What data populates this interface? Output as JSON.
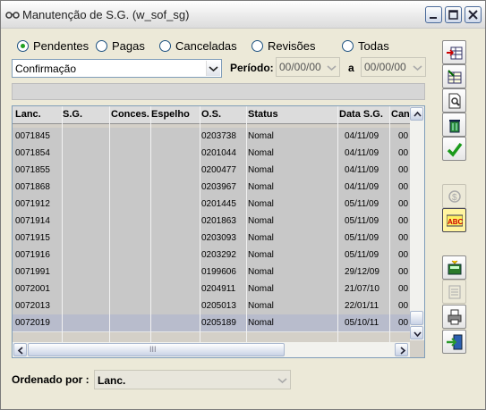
{
  "window": {
    "title": "Manutenção de S.G. (w_sof_sg)",
    "controls": [
      "minimize-icon",
      "maximize-icon",
      "close-icon"
    ]
  },
  "status_filter": {
    "options": [
      "Pendentes",
      "Pagas",
      "Canceladas",
      "Revisões",
      "Todas"
    ],
    "selected": "Pendentes"
  },
  "type_combo": {
    "value": "Confirmação"
  },
  "period": {
    "label": "Período:",
    "from": "00/00/00",
    "separator": "a",
    "to": "00/00/00"
  },
  "grid": {
    "columns": [
      "Lanc.",
      "S.G.",
      "Conces.",
      "Espelho",
      "O.S.",
      "Status",
      "Data S.G.",
      "Can"
    ],
    "rows": [
      [
        "0071845",
        "",
        "",
        "",
        "0203738",
        "Nomal",
        "04/11/09",
        "00"
      ],
      [
        "0071854",
        "",
        "",
        "",
        "0201044",
        "Nomal",
        "04/11/09",
        "00"
      ],
      [
        "0071855",
        "",
        "",
        "",
        "0200477",
        "Nomal",
        "04/11/09",
        "00"
      ],
      [
        "0071868",
        "",
        "",
        "",
        "0203967",
        "Nomal",
        "04/11/09",
        "00"
      ],
      [
        "0071912",
        "",
        "",
        "",
        "0201445",
        "Nomal",
        "05/11/09",
        "00"
      ],
      [
        "0071914",
        "",
        "",
        "",
        "0201863",
        "Nomal",
        "05/11/09",
        "00"
      ],
      [
        "0071915",
        "",
        "",
        "",
        "0203093",
        "Nomal",
        "05/11/09",
        "00"
      ],
      [
        "0071916",
        "",
        "",
        "",
        "0203292",
        "Nomal",
        "05/11/09",
        "00"
      ],
      [
        "0071991",
        "",
        "",
        "",
        "0199606",
        "Nomal",
        "29/12/09",
        "00"
      ],
      [
        "0072001",
        "",
        "",
        "",
        "0204911",
        "Nomal",
        "21/07/10",
        "00"
      ],
      [
        "0072013",
        "",
        "",
        "",
        "0205013",
        "Nomal",
        "22/01/11",
        "00"
      ],
      [
        "0072019",
        "",
        "",
        "",
        "0205189",
        "Nomal",
        "05/10/11",
        "00"
      ]
    ],
    "selected_row": 11,
    "hscroll_grip": "III"
  },
  "order": {
    "label": "Ordenado por :",
    "value": "Lanc."
  },
  "toolbar_icons": [
    "insert-row-icon",
    "edit-grid-icon",
    "print-preview-icon",
    "delete-icon",
    "confirm-check-icon",
    "money-icon",
    "spellcheck-abc-icon",
    "calculator-icon",
    "report-icon",
    "print-icon",
    "exit-icon"
  ],
  "colors": {
    "selected_row": "#b8bccc",
    "row_bg": "#c8c8c8",
    "radio_checked": "#21a121"
  }
}
